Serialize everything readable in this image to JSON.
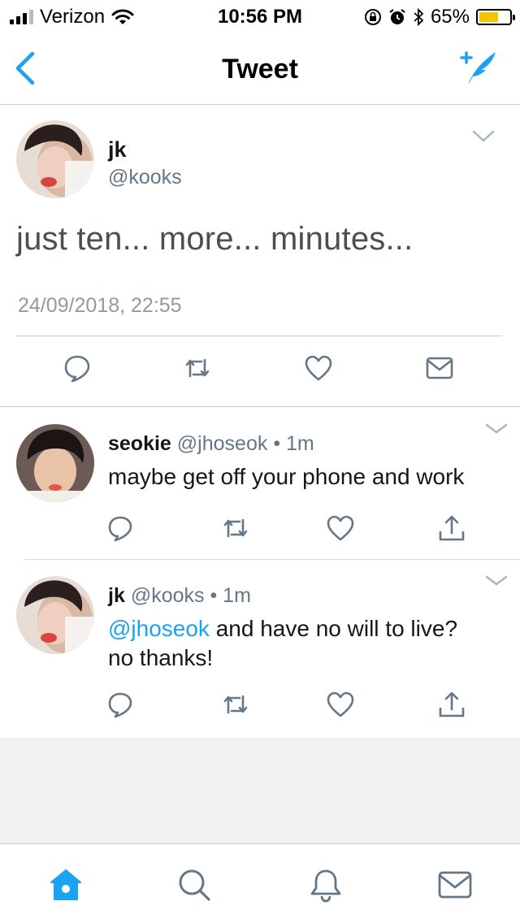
{
  "status_bar": {
    "carrier": "Verizon",
    "time": "10:56 PM",
    "battery_percent": "65%",
    "battery_level": 0.65,
    "icons": [
      "signal-icon",
      "wifi-icon",
      "orientation-lock-icon",
      "alarm-icon",
      "bluetooth-icon",
      "battery-icon"
    ]
  },
  "nav": {
    "title": "Tweet",
    "back_icon": "chevron-left-icon",
    "compose_icon": "compose-tweet-icon"
  },
  "main_tweet": {
    "name": "jk",
    "handle": "@kooks",
    "text": "just ten... more... minutes...",
    "date": "24/09/2018, 22:55",
    "actions": [
      "reply-icon",
      "retweet-icon",
      "like-icon",
      "message-icon"
    ]
  },
  "replies": [
    {
      "name": "seokie",
      "handle": "@jhoseok",
      "dot": "•",
      "time": "1m",
      "text": "maybe get off your phone and work",
      "actions": [
        "reply-icon",
        "retweet-icon",
        "like-icon",
        "share-icon"
      ]
    },
    {
      "name": "jk",
      "handle": "@kooks",
      "dot": "•",
      "time": "1m",
      "mention": "@jhoseok",
      "text_line1": " and have no will to live?",
      "text_line2": "no thanks!",
      "actions": [
        "reply-icon",
        "retweet-icon",
        "like-icon",
        "share-icon"
      ]
    }
  ],
  "tab_bar": {
    "tabs": [
      "home-icon",
      "search-icon",
      "notifications-icon",
      "messages-icon"
    ],
    "active": "home-icon"
  },
  "colors": {
    "accent": "#1da1f2",
    "text": "#14171a",
    "secondary": "#657786",
    "icon": "#657786",
    "battery": "#f5c400"
  }
}
